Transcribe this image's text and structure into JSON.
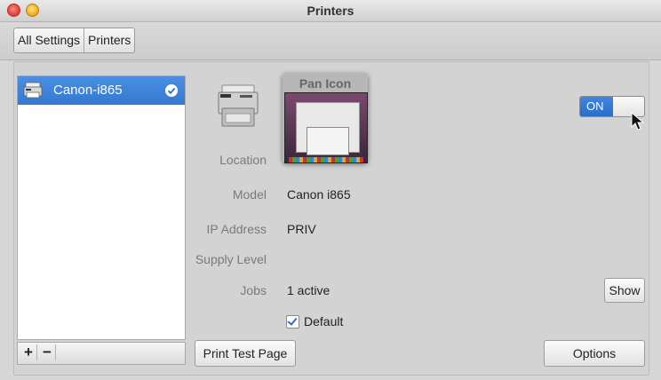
{
  "window": {
    "title": "Printers"
  },
  "toolbar": {
    "all_settings_label": "All Settings",
    "printers_label": "Printers"
  },
  "printers": [
    {
      "name": "Canon-i865",
      "selected": true,
      "default": true,
      "icon": "printer-icon"
    }
  ],
  "list_controls": {
    "add_label": "+",
    "remove_label": "−"
  },
  "overlay": {
    "title": "Pan Icon"
  },
  "toggle": {
    "on_label": "ON",
    "state": "on",
    "accent": "#2c6ecb"
  },
  "details": {
    "location_label": "Location",
    "model_label": "Model",
    "model_value": "Canon i865",
    "ip_label": "IP Address",
    "ip_value": "PRIV",
    "supply_label": "Supply Level",
    "jobs_label": "Jobs",
    "jobs_value": "1 active",
    "show_label": "Show",
    "default_label": "Default",
    "default_checked": true
  },
  "actions": {
    "print_test_label": "Print Test Page",
    "options_label": "Options"
  }
}
